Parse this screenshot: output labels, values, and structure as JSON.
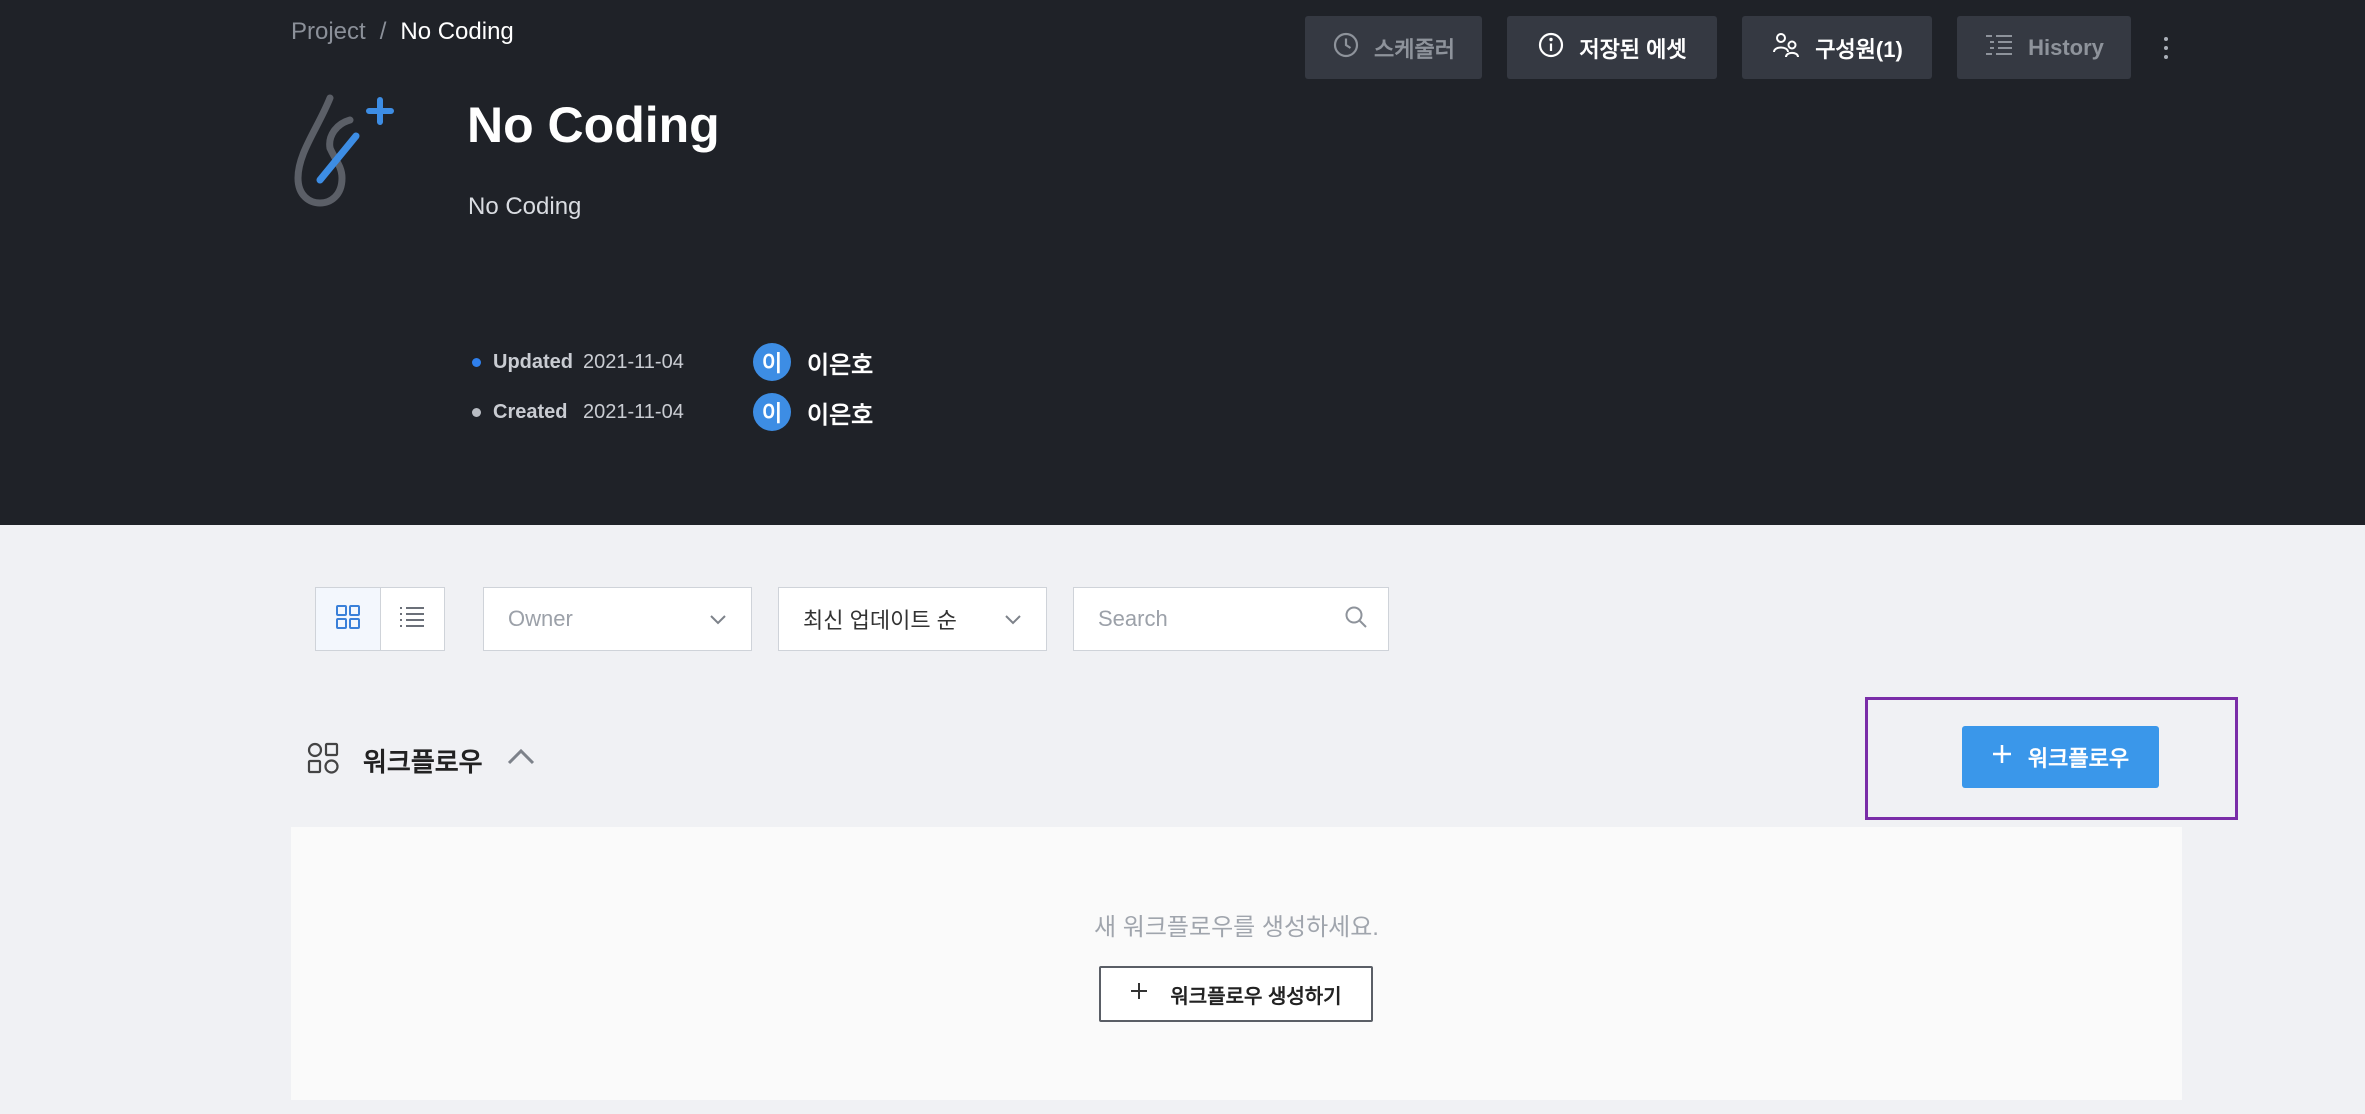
{
  "breadcrumb": {
    "root": "Project",
    "separator": "/",
    "current": "No Coding"
  },
  "top_actions": {
    "scheduler": {
      "label": "스케줄러",
      "icon": "clock-icon",
      "enabled": false
    },
    "saved_assets": {
      "label": "저장된 에셋",
      "icon": "info-icon",
      "enabled": true
    },
    "members": {
      "label": "구성원(1)",
      "icon": "members-icon",
      "enabled": true
    },
    "history": {
      "label": "History",
      "icon": "history-icon",
      "enabled": false
    },
    "more": {
      "icon": "more-vertical-icon"
    }
  },
  "project": {
    "logo_icon": "droplet-sparkle-icon",
    "title": "No Coding",
    "description": "No Coding",
    "updated": {
      "label": "Updated",
      "date": "2021-11-04",
      "avatar_initial": "이",
      "user": "이은호",
      "dot_color": "#2f80ed"
    },
    "created": {
      "label": "Created",
      "date": "2021-11-04",
      "avatar_initial": "이",
      "user": "이은호",
      "dot_color": "#b8bcc3"
    }
  },
  "toolbar": {
    "view_modes": [
      "grid-view-icon",
      "list-view-icon"
    ],
    "active_view": "grid",
    "owner_select": {
      "placeholder": "Owner"
    },
    "sort_select": {
      "value": "최신 업데이트 순"
    },
    "search": {
      "placeholder": "Search",
      "value": ""
    }
  },
  "workflow_section": {
    "icon": "workflow-icon",
    "title": "워크플로우",
    "add_button_label": "워크플로우",
    "empty_message": "새 워크플로우를 생성하세요.",
    "create_button_label": "워크플로우 생성하기"
  },
  "colors": {
    "header_bg": "#1f2228",
    "accent": "#3a97ea",
    "highlight": "#7a2da8",
    "page_bg": "#f0f1f4"
  }
}
